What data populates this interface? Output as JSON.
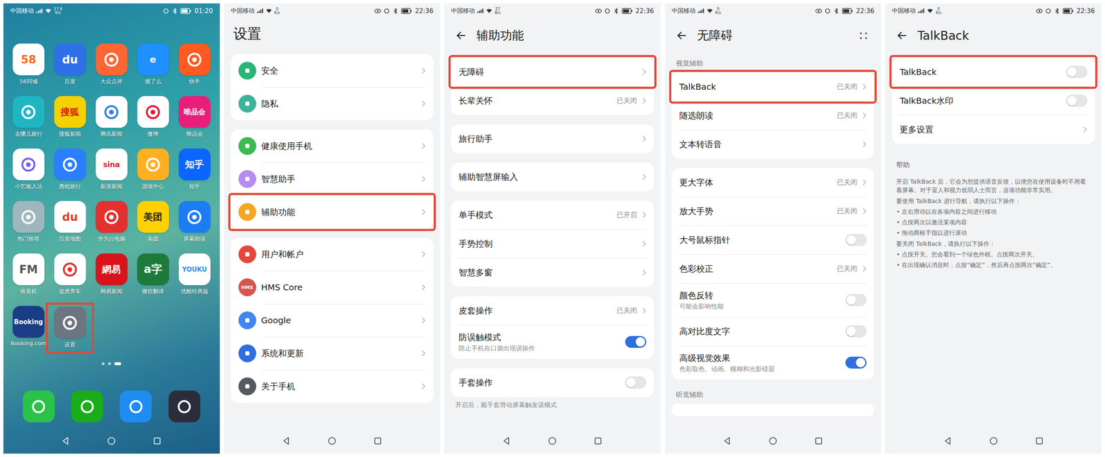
{
  "home": {
    "status": {
      "carrier": "中国移动",
      "speed": "17.9",
      "speed_unit": "K/s",
      "time": "01:20"
    },
    "apps": [
      {
        "name": "58同城",
        "glyph": "58",
        "color": "#ffffff",
        "ink": "#f26b21",
        "highlighted": false
      },
      {
        "name": "百度",
        "glyph": "du",
        "color": "#2f6fe8",
        "ink": "#ffffff",
        "highlighted": false
      },
      {
        "name": "大众点评",
        "color": "#ff6633",
        "ink": "#ffffff",
        "highlighted": false
      },
      {
        "name": "饿了么",
        "glyph": "e",
        "color": "#1e90ff",
        "ink": "#ffffff",
        "highlighted": false
      },
      {
        "name": "快手",
        "color": "#ff5a1f",
        "ink": "#ffffff",
        "highlighted": false
      },
      {
        "name": "去哪儿旅行",
        "color": "#1fb6c4",
        "ink": "#ffffff",
        "highlighted": false
      },
      {
        "name": "搜狐新闻",
        "glyph": "搜狐",
        "color": "#f6d100",
        "ink": "#d81e06",
        "highlighted": false
      },
      {
        "name": "腾讯新闻",
        "color": "#ffffff",
        "ink": "#2e7de1",
        "highlighted": false
      },
      {
        "name": "微博",
        "color": "#ffffff",
        "ink": "#e6162d",
        "highlighted": false
      },
      {
        "name": "唯品会",
        "glyph": "唯品会",
        "color": "#e91e7b",
        "ink": "#ffffff",
        "highlighted": false
      },
      {
        "name": "小艺输入法",
        "color": "#ffffff",
        "ink": "#7b5cf0",
        "highlighted": false
      },
      {
        "name": "携程旅行",
        "color": "#2a7fff",
        "ink": "#ffffff",
        "highlighted": false
      },
      {
        "name": "新浪新闻",
        "glyph": "sina",
        "color": "#ffffff",
        "ink": "#e6162d",
        "highlighted": false
      },
      {
        "name": "游戏中心",
        "color": "#ffb020",
        "ink": "#ffffff",
        "highlighted": false
      },
      {
        "name": "知乎",
        "glyph": "知乎",
        "color": "#0a66ff",
        "ink": "#ffffff",
        "highlighted": false
      },
      {
        "name": "热门推荐",
        "color": "#9fb6bf",
        "ink": "#ffffff",
        "highlighted": false
      },
      {
        "name": "百度地图",
        "glyph": "du",
        "color": "#ffffff",
        "ink": "#e43b30",
        "highlighted": false
      },
      {
        "name": "华为云电脑",
        "color": "#e5302f",
        "ink": "#ffffff",
        "highlighted": false
      },
      {
        "name": "美团",
        "glyph": "美团",
        "color": "#ffd100",
        "ink": "#222222",
        "highlighted": false
      },
      {
        "name": "屏幕朗读",
        "color": "#1e7cf2",
        "ink": "#ffffff",
        "highlighted": false
      },
      {
        "name": "收音机",
        "glyph": "FM",
        "color": "#ffffff",
        "ink": "#555555",
        "highlighted": false
      },
      {
        "name": "途虎养车",
        "color": "#ffffff",
        "ink": "#e5302f",
        "highlighted": false
      },
      {
        "name": "网易新闻",
        "glyph": "網易",
        "color": "#d8131c",
        "ink": "#ffffff",
        "highlighted": false
      },
      {
        "name": "微软翻译",
        "glyph": "a字",
        "color": "#1d7a3a",
        "ink": "#ffffff",
        "highlighted": false
      },
      {
        "name": "优酷经典版",
        "glyph": "YOUKU",
        "color": "#ffffff",
        "ink": "#2a8cff",
        "highlighted": false
      },
      {
        "name": "Booking.com",
        "glyph": "Booking",
        "color": "#1b3d85",
        "ink": "#ffffff",
        "highlighted": false
      },
      {
        "name": "设置",
        "color": "#6d7580",
        "ink": "#ffffff",
        "highlighted": true
      }
    ],
    "page_dots": [
      {
        "selected": false
      },
      {
        "selected": false
      },
      {
        "selected": true
      }
    ],
    "dock": [
      {
        "color": "#2bc24a"
      },
      {
        "color": "#1aad19"
      },
      {
        "color": "#1e8cf0"
      },
      {
        "color": "#2b2d3a"
      }
    ]
  },
  "settings": {
    "status": {
      "carrier": "中国移动",
      "speed": "0",
      "speed_unit": "K/s",
      "time": "22:36"
    },
    "title": "设置",
    "groups": [
      [
        {
          "label": "安全",
          "color": "#2bb57a",
          "highlighted": false
        },
        {
          "label": "隐私",
          "color": "#3fb39a",
          "highlighted": false
        }
      ],
      [
        {
          "label": "健康使用手机",
          "color": "#3cba54",
          "highlighted": false
        },
        {
          "label": "智慧助手",
          "color": "#b58cf0",
          "highlighted": false
        },
        {
          "label": "辅助功能",
          "color": "#f5a623",
          "highlighted": true
        }
      ],
      [
        {
          "label": "用户和帐户",
          "color": "#e5483b",
          "highlighted": false
        },
        {
          "label": "HMS Core",
          "glyph": "HMS",
          "color": "#d9534f",
          "highlighted": false
        },
        {
          "label": "Google",
          "color": "#4285f4",
          "highlighted": false
        },
        {
          "label": "系统和更新",
          "color": "#2f6fe0",
          "highlighted": false
        },
        {
          "label": "关于手机",
          "color": "#555a60",
          "highlighted": false
        }
      ]
    ]
  },
  "lists": [
    {
      "status": {
        "carrier": "中国移动",
        "speed": "27",
        "speed_unit": "B/s",
        "time": "22:36"
      },
      "title": "辅助功能",
      "sections": [
        {
          "items": [
            {
              "label": "无障碍",
              "kind": "link",
              "highlighted": true
            },
            {
              "label": "长辈关怀",
              "kind": "link",
              "value": "已关闭",
              "highlighted": false
            }
          ]
        },
        {
          "items": [
            {
              "label": "旅行助手",
              "kind": "link",
              "highlighted": false
            }
          ]
        },
        {
          "items": [
            {
              "label": "辅助智慧屏输入",
              "kind": "link",
              "highlighted": false
            }
          ]
        },
        {
          "items": [
            {
              "label": "单手模式",
              "kind": "link",
              "value": "已开启",
              "highlighted": false
            },
            {
              "label": "手势控制",
              "kind": "link",
              "highlighted": false
            },
            {
              "label": "智慧多窗",
              "kind": "link",
              "highlighted": false
            }
          ]
        },
        {
          "items": [
            {
              "label": "皮套操作",
              "kind": "link",
              "value": "已关闭",
              "highlighted": false
            },
            {
              "label": "防误触模式",
              "kind": "toggle",
              "sub": "防止手机在口袋出现误操作",
              "on": true,
              "highlighted": false
            }
          ]
        },
        {
          "items": [
            {
              "label": "手套操作",
              "kind": "toggle",
              "on": false,
              "highlighted": false
            }
          ]
        }
      ],
      "footer": "开启后，戴手套滑动屏幕触发该模式"
    },
    {
      "status": {
        "carrier": "中国移动",
        "speed": "0",
        "speed_unit": "K/s",
        "time": "22:36"
      },
      "title": "无障碍",
      "more": "∷",
      "sections": [
        {
          "label": "视觉辅助",
          "items": [
            {
              "label": "TalkBack",
              "kind": "link",
              "value": "已关闭",
              "highlighted": true
            },
            {
              "label": "随选朗读",
              "kind": "link",
              "value": "已关闭",
              "highlighted": false
            },
            {
              "label": "文本转语音",
              "kind": "link",
              "highlighted": false
            }
          ]
        },
        {
          "items": [
            {
              "label": "更大字体",
              "kind": "link",
              "value": "已关闭",
              "highlighted": false
            },
            {
              "label": "放大手势",
              "kind": "link",
              "value": "已关闭",
              "highlighted": false
            },
            {
              "label": "大号鼠标指针",
              "kind": "toggle",
              "on": false,
              "highlighted": false
            },
            {
              "label": "色彩校正",
              "kind": "link",
              "value": "已关闭",
              "highlighted": false
            },
            {
              "label": "颜色反转",
              "kind": "toggle",
              "sub": "可能会影响性能",
              "on": false,
              "highlighted": false
            },
            {
              "label": "高对比度文字",
              "kind": "toggle",
              "on": false,
              "highlighted": false
            },
            {
              "label": "高级视觉效果",
              "kind": "toggle",
              "sub": "色彩取色、动画、模糊和光影错层",
              "on": true,
              "highlighted": false
            }
          ]
        },
        {
          "label": "听觉辅助",
          "items": []
        }
      ]
    },
    {
      "status": {
        "carrier": "中国移动",
        "speed": "0",
        "speed_unit": "K/s",
        "time": "22:36"
      },
      "title": "TalkBack",
      "sections": [
        {
          "items": [
            {
              "label": "TalkBack",
              "kind": "toggle",
              "on": false,
              "highlighted": true
            },
            {
              "label": "TalkBack水印",
              "kind": "toggle",
              "on": false,
              "highlighted": false
            },
            {
              "label": "更多设置",
              "kind": "link",
              "highlighted": false
            }
          ]
        }
      ],
      "help": {
        "title": "帮助",
        "lines": [
          "开启 TalkBack 后，它会为您提供语音反馈，以便您在使用设备时不用看着屏幕。对于盲人和视力低弱人士而言，这项功能非常实用。",
          "要使用 TalkBack 进行导航，请执行以下操作：",
          "• 左右滑动以在各项内容之间进行移动",
          "• 点按两次以激活某项内容",
          "• 拖动两根手指以进行滚动",
          "要关闭 TalkBack，请执行以下操作：",
          "• 点按开关。您会看到一个绿色外框。点按两次开关。",
          "• 在出现确认消息时，点按“确定”，然后再点按两次“确定”。"
        ]
      }
    }
  ]
}
